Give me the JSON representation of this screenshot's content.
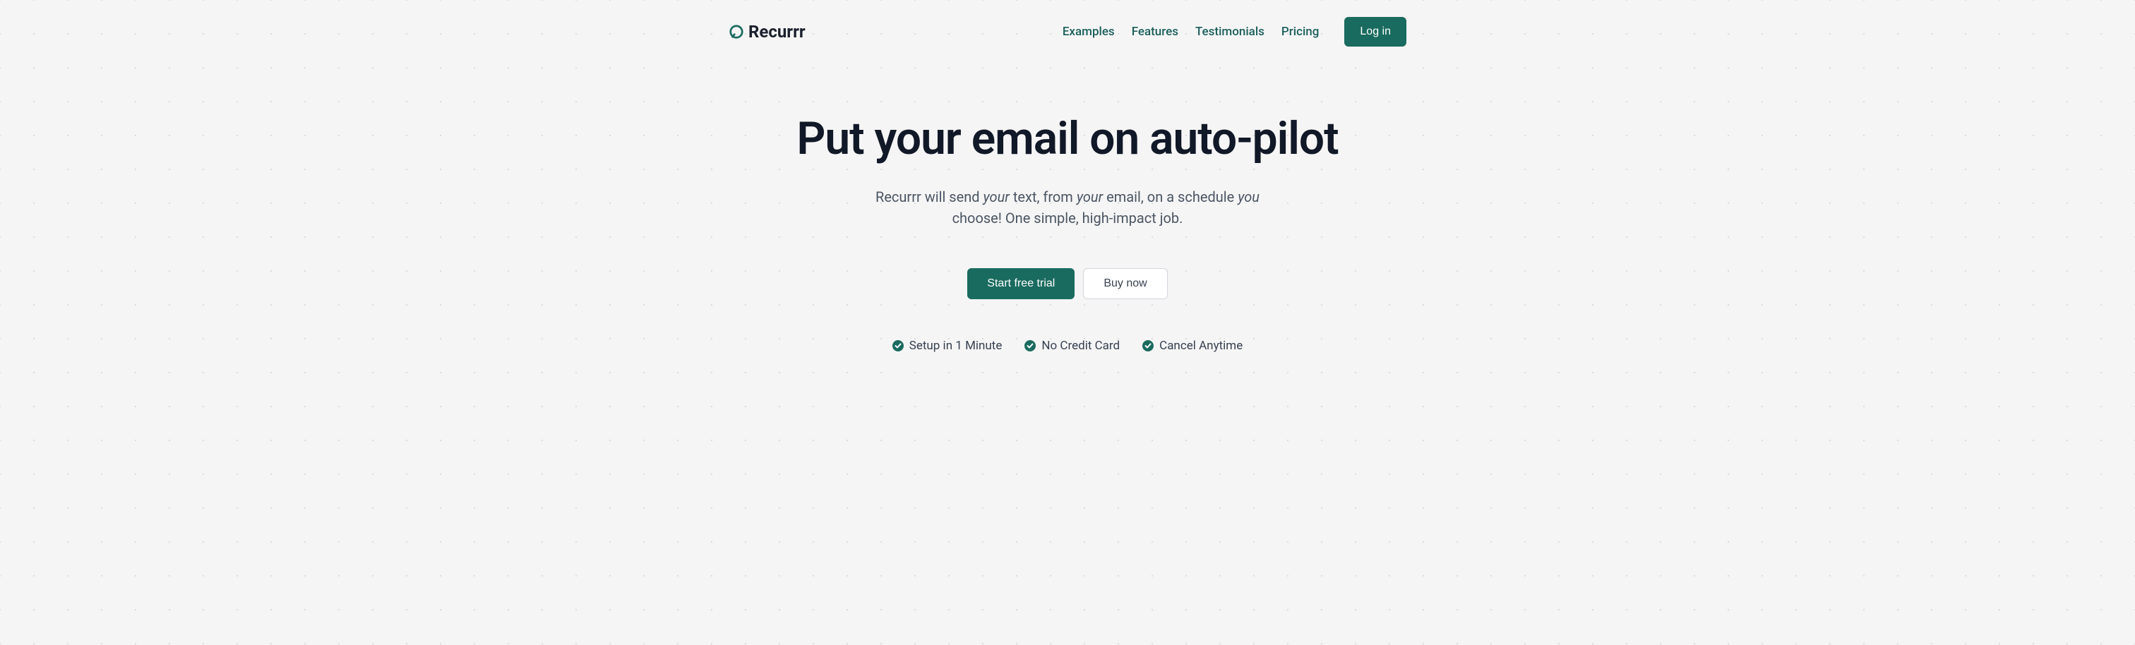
{
  "brand": {
    "name": "Recurrr"
  },
  "nav": {
    "links": [
      {
        "label": "Examples"
      },
      {
        "label": "Features"
      },
      {
        "label": "Testimonials"
      },
      {
        "label": "Pricing"
      }
    ],
    "login": "Log in"
  },
  "hero": {
    "title": "Put your email on auto-pilot",
    "subtitle_part1": "Recurrr will send ",
    "subtitle_em1": "your",
    "subtitle_part2": " text, from ",
    "subtitle_em2": "your",
    "subtitle_part3": " email, on a schedule ",
    "subtitle_em3": "you",
    "subtitle_part4": " choose! One simple, high-impact job.",
    "cta_primary": "Start free trial",
    "cta_secondary": "Buy now"
  },
  "features": {
    "items": [
      {
        "label": "Setup in 1 Minute"
      },
      {
        "label": "No Credit Card"
      },
      {
        "label": "Cancel Anytime"
      }
    ]
  },
  "colors": {
    "accent": "#1a6b5f"
  }
}
